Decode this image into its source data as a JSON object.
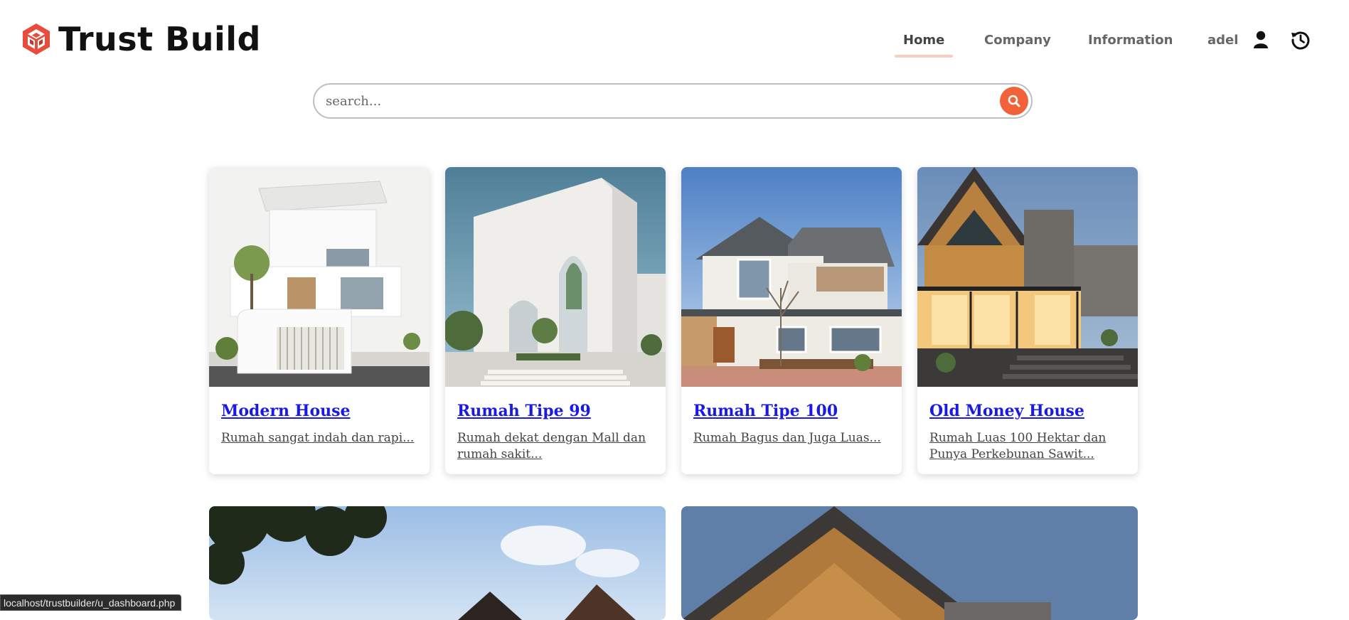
{
  "header": {
    "logo_text": "Trust Build",
    "brand_color": "#e74c3c"
  },
  "nav": {
    "items": [
      {
        "label": "Home",
        "active": true
      },
      {
        "label": "Company",
        "active": false
      },
      {
        "label": "Information",
        "active": false
      },
      {
        "label": "adel",
        "active": false
      }
    ],
    "user_icon": "user-icon",
    "history_icon": "history-icon"
  },
  "search": {
    "placeholder": "search...",
    "value": "",
    "button_color": "#f2623a"
  },
  "cards": [
    {
      "title": "Modern House",
      "description": "Rumah sangat indah dan rapi..."
    },
    {
      "title": "Rumah Tipe 99",
      "description": "Rumah dekat dengan Mall dan rumah sakit..."
    },
    {
      "title": "Rumah Tipe 100",
      "description": "Rumah Bagus dan Juga Luas..."
    },
    {
      "title": "Old Money House",
      "description": "Rumah Luas 100 Hektar dan Punya Perkebunan Sawit..."
    }
  ],
  "status_bar": {
    "url": "localhost/trustbuilder/u_dashboard.php"
  }
}
